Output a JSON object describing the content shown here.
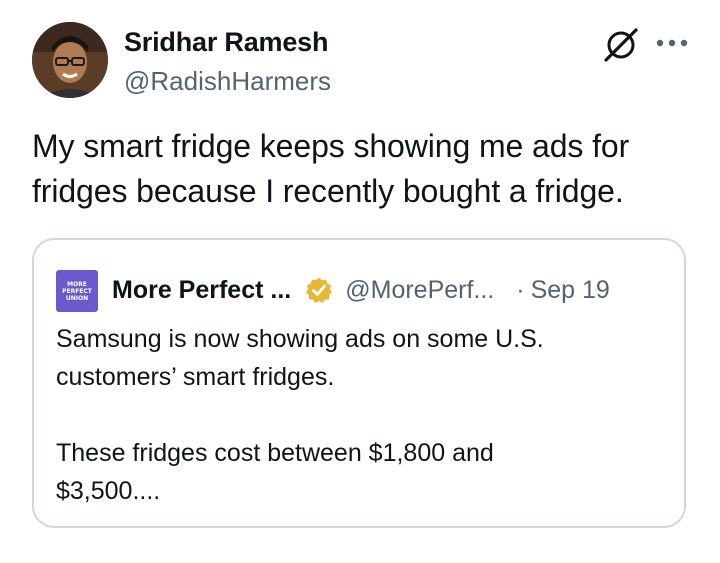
{
  "author": {
    "display_name": "Sridhar Ramesh",
    "handle": "@RadishHarmers"
  },
  "header_icons": {
    "grok": "grok-icon",
    "more": "more-icon"
  },
  "tweet": {
    "lines": [
      "My smart fridge keeps showing me ads for",
      "fridges because I recently bought a fridge."
    ]
  },
  "quote": {
    "logo_lines": [
      "MORE",
      "PERFECT",
      "UNION"
    ],
    "display_name": "More Perfect ...",
    "verified_icon": "verified-badge-icon",
    "handle": "@MorePerf...",
    "dot": "·",
    "date": "Sep 19",
    "paragraph1": [
      "Samsung is now showing ads on some U.S.",
      "customers’ smart fridges."
    ],
    "paragraph2": [
      "These fridges cost between $1,800 and",
      "$3,500...."
    ]
  },
  "colors": {
    "text": "#0f1419",
    "secondary": "#536471",
    "border": "#cfd9de",
    "logo_bg": "#6a5acd",
    "verified": "#e8b73a"
  }
}
